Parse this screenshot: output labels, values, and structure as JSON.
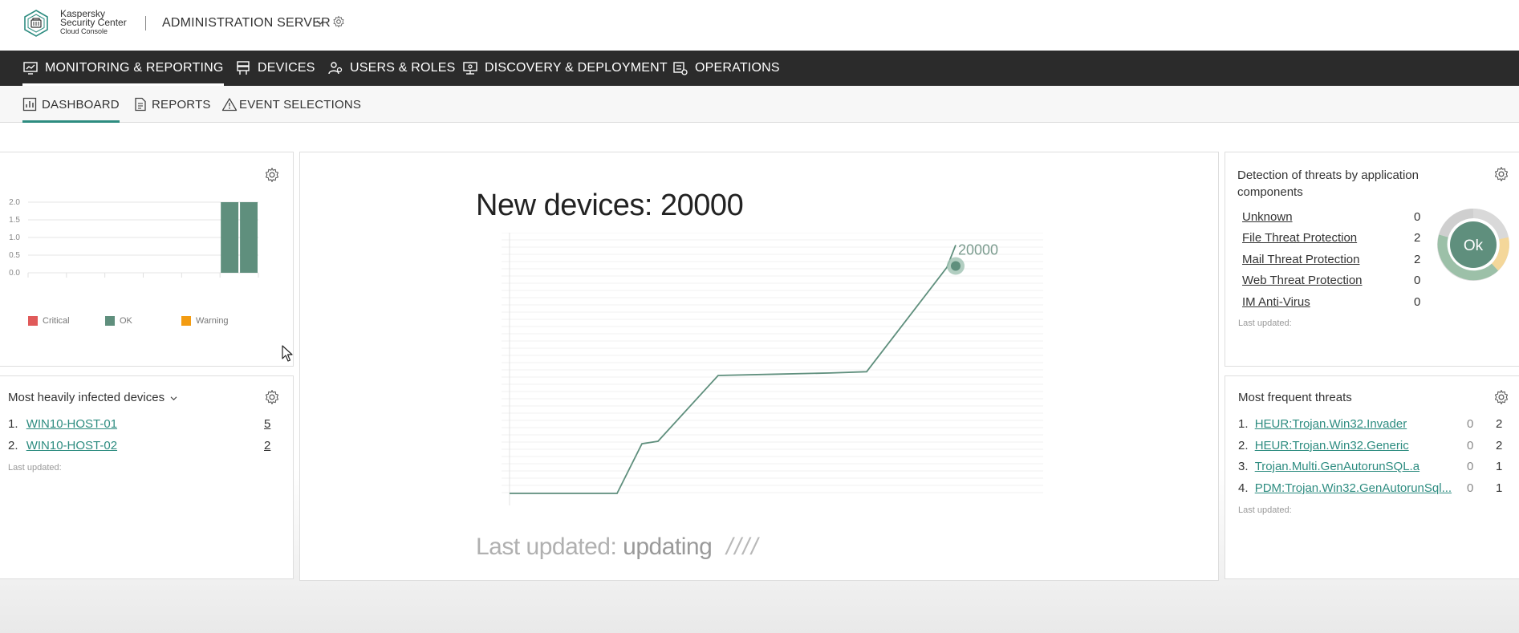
{
  "brand": {
    "line1": "Kaspersky",
    "line2": "Security Center",
    "line3": "Cloud Console"
  },
  "server": {
    "label": "ADMINISTRATION SERVER"
  },
  "main_nav": [
    {
      "label": "MONITORING & REPORTING",
      "icon": "monitor-chart-icon",
      "active": true
    },
    {
      "label": "DEVICES",
      "icon": "server-rack-icon",
      "active": false
    },
    {
      "label": "USERS & ROLES",
      "icon": "users-icon",
      "active": false
    },
    {
      "label": "DISCOVERY & DEPLOYMENT",
      "icon": "network-monitor-icon",
      "active": false
    },
    {
      "label": "OPERATIONS",
      "icon": "operations-icon",
      "active": false
    }
  ],
  "sub_nav": [
    {
      "label": "DASHBOARD",
      "icon": "dashboard-icon",
      "active": true
    },
    {
      "label": "REPORTS",
      "icon": "document-icon",
      "active": false
    },
    {
      "label": "EVENT SELECTIONS",
      "icon": "warning-triangle-icon",
      "active": false
    }
  ],
  "status_widget": {
    "legend": [
      "Critical",
      "OK",
      "Warning"
    ],
    "legend_colors": [
      "#e05a5a",
      "#5f8f7d",
      "#f39c12"
    ]
  },
  "chart_data": [
    {
      "type": "bar",
      "y_ticks": [
        "2.0",
        "1.5",
        "1.0",
        "0.5",
        "0.0"
      ],
      "ylim": [
        0,
        2
      ],
      "series": [
        {
          "name": "Critical",
          "color": "#e05a5a",
          "values": [
            0,
            0,
            0,
            0,
            0,
            0,
            0,
            0,
            0,
            0,
            0,
            0
          ]
        },
        {
          "name": "OK",
          "color": "#5f8f7d",
          "values": [
            0,
            0,
            0,
            0,
            0,
            0,
            0,
            0,
            0,
            0,
            2,
            2
          ]
        },
        {
          "name": "Warning",
          "color": "#f39c12",
          "values": [
            0,
            0,
            0,
            0,
            0,
            0,
            0,
            0,
            0,
            0,
            0,
            0
          ]
        }
      ],
      "legend": "bottom",
      "grid": true
    },
    {
      "type": "line",
      "title": "New devices: 20000",
      "x": [
        0,
        1,
        2,
        3,
        4,
        5,
        6,
        7,
        8,
        9
      ],
      "y": [
        0,
        0,
        0,
        4000,
        4200,
        9500,
        9600,
        9700,
        9800,
        18200,
        20000
      ],
      "ylim": [
        0,
        21000
      ],
      "annotation": "20000",
      "color": "#5f8f7d",
      "grid": true
    }
  ],
  "infected_devices": {
    "title": "Most heavily infected devices",
    "rows": [
      {
        "num": "1.",
        "name": "WIN10-HOST-01",
        "count": "5"
      },
      {
        "num": "2.",
        "name": "WIN10-HOST-02",
        "count": "2"
      }
    ],
    "last_updated": "Last updated:"
  },
  "new_devices": {
    "title": "New devices: 20000",
    "last_updated_label": "Last updated:",
    "last_updated_value": "updating",
    "slashes": "////"
  },
  "detection": {
    "title": "Detection of threats by application components",
    "rows": [
      {
        "name": "Unknown",
        "count": "0"
      },
      {
        "name": "File Threat Protection",
        "count": "2"
      },
      {
        "name": "Mail Threat Protection",
        "count": "2"
      },
      {
        "name": "Web Threat Protection",
        "count": "0"
      },
      {
        "name": "IM Anti-Virus",
        "count": "0"
      }
    ],
    "last_updated": "Last updated:",
    "status": "Ok"
  },
  "frequent_threats": {
    "title": "Most frequent threats",
    "rows": [
      {
        "num": "1.",
        "name": "HEUR:Trojan.Win32.Invader",
        "a": "0",
        "b": "2"
      },
      {
        "num": "2.",
        "name": "HEUR:Trojan.Win32.Generic",
        "a": "0",
        "b": "2"
      },
      {
        "num": "3.",
        "name": "Trojan.Multi.GenAutorunSQL.a",
        "a": "0",
        "b": "1"
      },
      {
        "num": "4.",
        "name": "PDM:Trojan.Win32.GenAutorunSql...",
        "a": "0",
        "b": "1"
      }
    ],
    "last_updated": "Last updated:"
  }
}
